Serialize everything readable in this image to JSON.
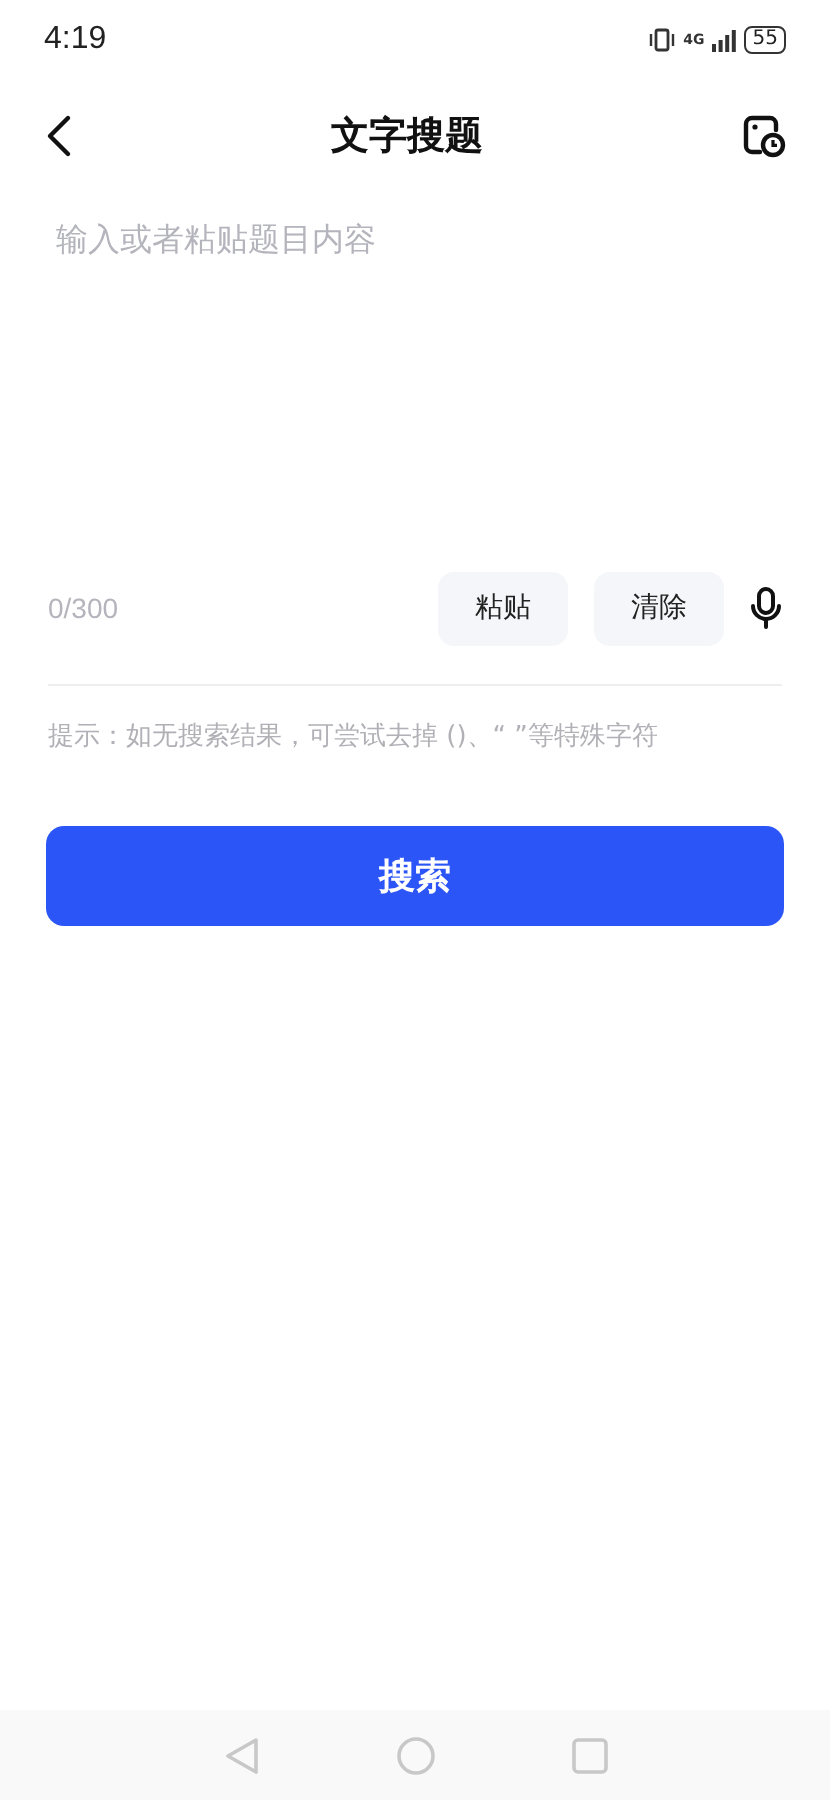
{
  "status_bar": {
    "time": "4:19",
    "network": "4G",
    "battery": "55"
  },
  "header": {
    "title": "文字搜题"
  },
  "input": {
    "placeholder": "输入或者粘贴题目内容",
    "counter": "0/300"
  },
  "actions": [
    "粘贴",
    "清除"
  ],
  "hint": "提示：如无搜索结果，可尝试去掉 ()、“ ”等特殊字符",
  "search_button": "搜索"
}
